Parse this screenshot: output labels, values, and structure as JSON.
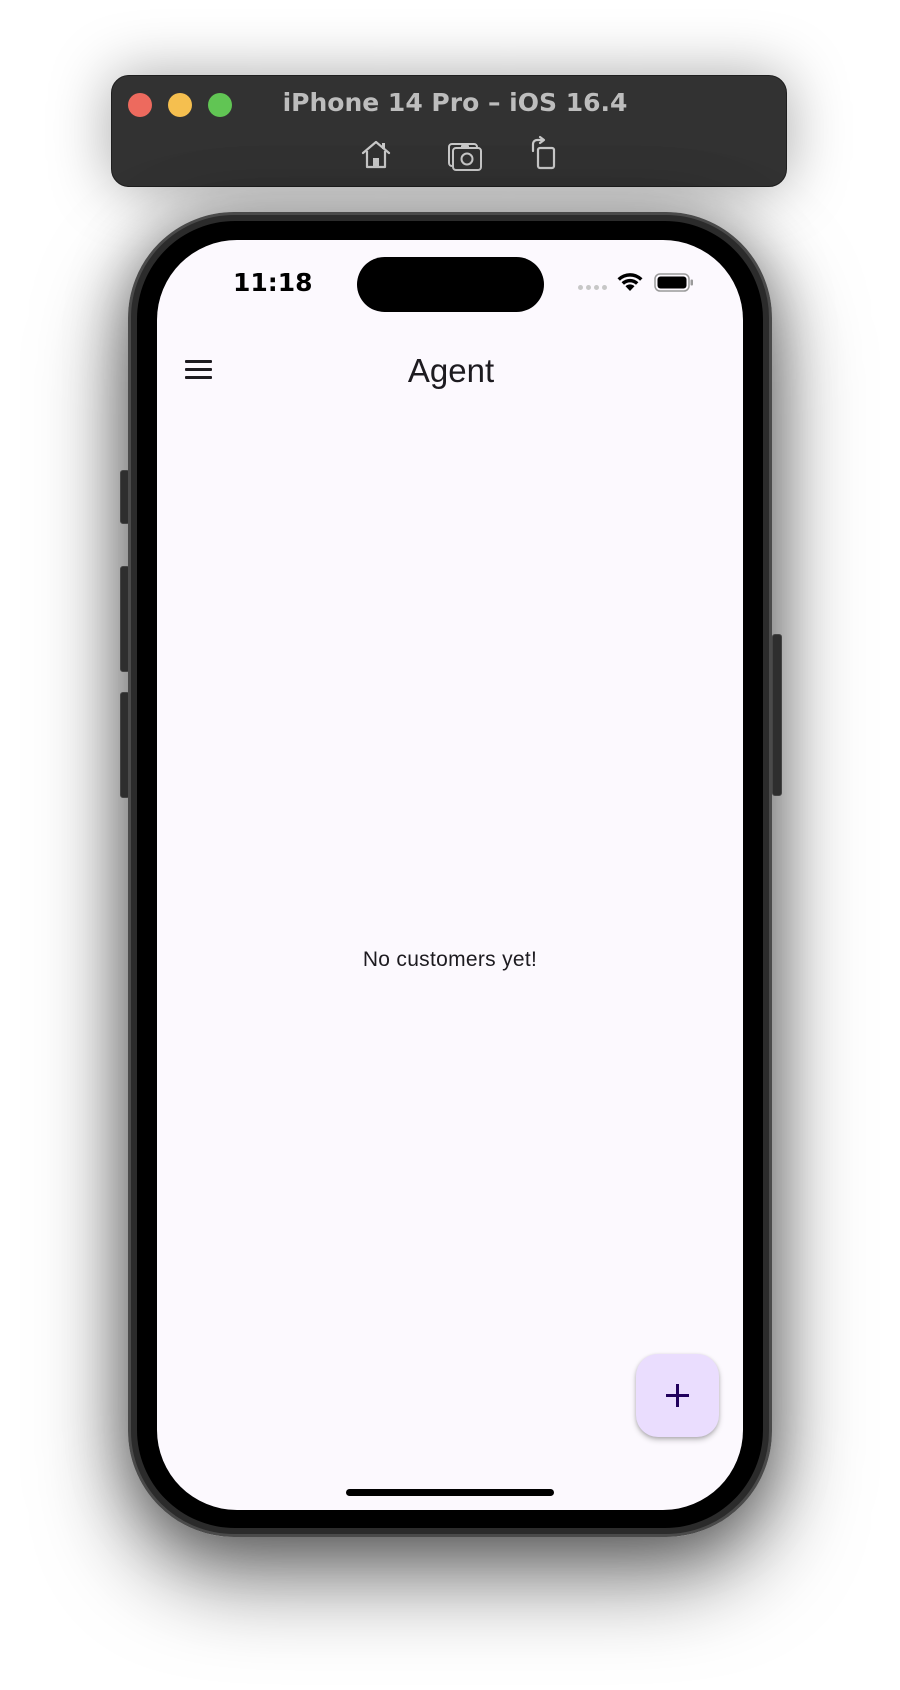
{
  "simulator": {
    "title": "iPhone 14 Pro – iOS 16.4",
    "toolbar_icons": [
      "home-icon",
      "screenshot-icon",
      "rotate-icon"
    ],
    "window_controls": [
      "close",
      "minimize",
      "maximize"
    ]
  },
  "status_bar": {
    "time": "11:18",
    "icons": [
      "cellular-signal-icon",
      "wifi-icon",
      "battery-icon"
    ]
  },
  "app_bar": {
    "menu_icon": "menu-icon",
    "title": "Agent"
  },
  "main": {
    "empty_message": "No customers yet!"
  },
  "fab": {
    "icon": "plus-icon",
    "color": "#eaddfe"
  },
  "colors": {
    "screen_background": "#fcf9fe",
    "text": "#1d1b20",
    "toolbar": "#323232"
  }
}
